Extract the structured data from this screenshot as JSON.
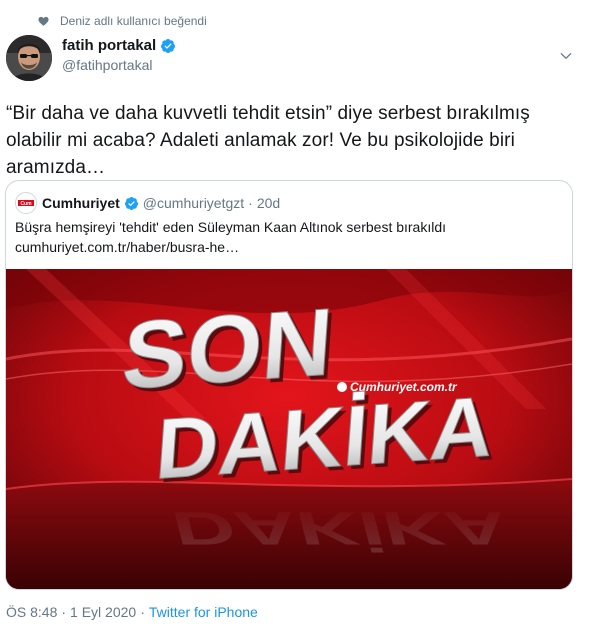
{
  "social_context": {
    "text": "Deniz adlı kullanıcı beğendi"
  },
  "author": {
    "display_name": "fatih portakal",
    "handle": "@fatihportakal"
  },
  "tweet": {
    "text": "“Bir daha ve daha kuvvetli tehdit etsin” diye serbest bırakılmış olabilir mi acaba? Adaleti anlamak zor! Ve bu psikolojide biri aramızda…"
  },
  "quote": {
    "avatar_text": "Cum",
    "display_name": "Cumhuriyet",
    "handle": "@cumhuriyetgzt",
    "separator": "·",
    "time": "20d",
    "text": "Büşra hemşireyi 'tehdit' eden Süleyman Kaan Altınok serbest bırakıldı",
    "link": "cumhuriyet.com.tr/haber/busra-he…",
    "media": {
      "line1": "SON",
      "line2": "DAKİKA",
      "watermark": "Cumhuriyet.com.tr"
    }
  },
  "meta": {
    "time": "ÖS 8:48",
    "dot": "·",
    "date": "1 Eyl 2020",
    "dot2": "·",
    "source": "Twitter for iPhone"
  },
  "colors": {
    "accent": "#1da1f2",
    "muted": "#657786",
    "media_red": "#c4121a"
  },
  "icons": {
    "social": "heart-icon",
    "verified": "verified-badge-icon",
    "menu": "chevron-down-icon"
  }
}
